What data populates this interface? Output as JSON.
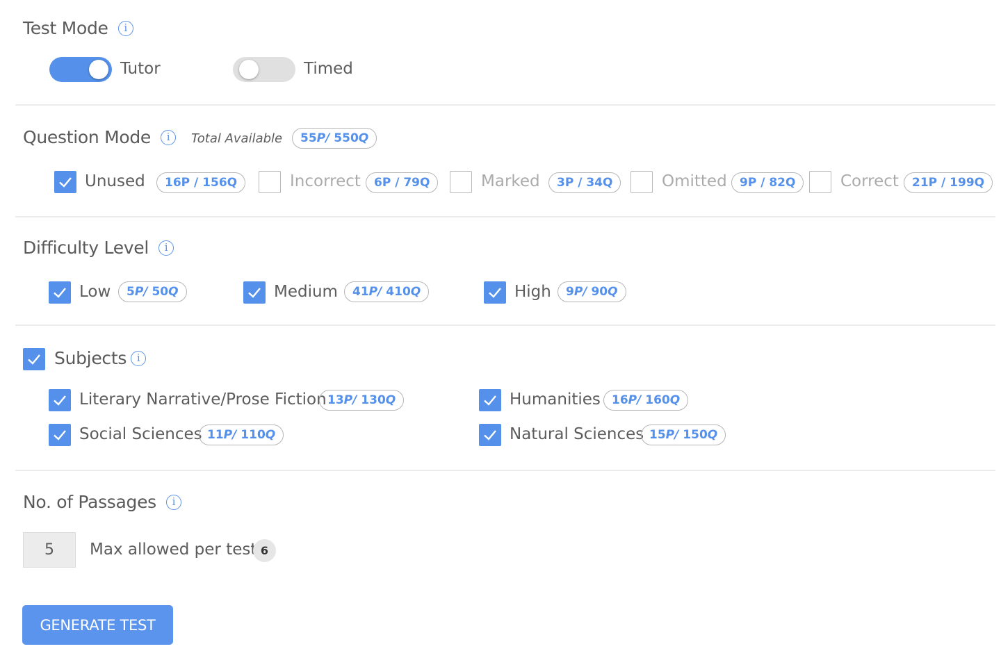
{
  "colors": {
    "accent": "#5591ea",
    "text": "#5c5c5c",
    "muted": "#ababab",
    "divider": "#ebebeb"
  },
  "test_mode": {
    "title": "Test Mode",
    "info_icon": "info-icon",
    "options": [
      {
        "label": "Tutor",
        "on": true
      },
      {
        "label": "Timed",
        "on": false
      }
    ]
  },
  "question_mode": {
    "title": "Question Mode",
    "info_icon": "info-icon",
    "total_label": "Total Available",
    "total_p": "55P",
    "total_q": "550Q",
    "options": [
      {
        "label": "Unused",
        "count": "16P / 156Q",
        "checked": true
      },
      {
        "label": "Incorrect",
        "count": "6P / 79Q",
        "checked": false
      },
      {
        "label": "Marked",
        "count": "3P / 34Q",
        "checked": false
      },
      {
        "label": "Omitted",
        "count": "9P / 82Q",
        "checked": false
      },
      {
        "label": "Correct",
        "count": "21P / 199Q",
        "checked": false
      }
    ]
  },
  "difficulty": {
    "title": "Difficulty Level",
    "info_icon": "info-icon",
    "options": [
      {
        "label": "Low",
        "p": "5P",
        "q": "50Q",
        "checked": true
      },
      {
        "label": "Medium",
        "p": "41P",
        "q": "410Q",
        "checked": true
      },
      {
        "label": "High",
        "p": "9P",
        "q": "90Q",
        "checked": true
      }
    ]
  },
  "subjects": {
    "title": "Subjects",
    "checked": true,
    "info_icon": "info-icon",
    "options": [
      {
        "label": "Literary Narrative/Prose Fiction",
        "p": "13P",
        "q": "130Q",
        "checked": true
      },
      {
        "label": "Humanities",
        "p": "16P",
        "q": "160Q",
        "checked": true
      },
      {
        "label": "Social Sciences",
        "p": "11P",
        "q": "110Q",
        "checked": true
      },
      {
        "label": "Natural Sciences",
        "p": "15P",
        "q": "150Q",
        "checked": true
      }
    ]
  },
  "passages": {
    "title": "No. of Passages",
    "info_icon": "info-icon",
    "value": "5",
    "max_label": "Max allowed per test",
    "max_value": "6"
  },
  "actions": {
    "generate_label": "GENERATE TEST"
  }
}
